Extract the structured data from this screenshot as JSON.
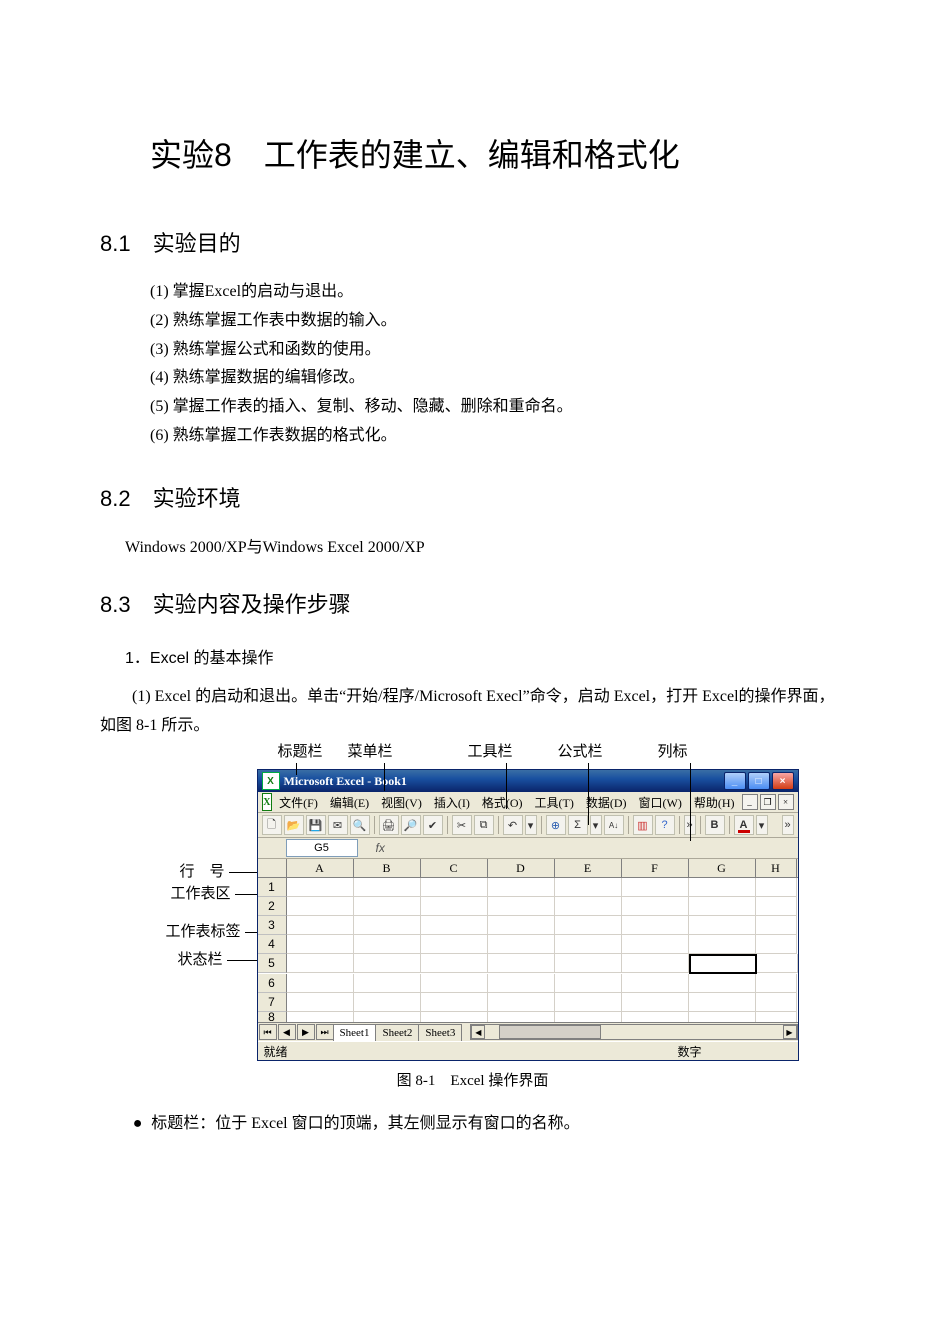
{
  "title": "实验8　工作表的建立、编辑和格式化",
  "sections": {
    "s81": {
      "heading": "8.1　实验目的",
      "items": [
        "(1)  掌握Excel的启动与退出。",
        "(2)  熟练掌握工作表中数据的输入。",
        "(3)  熟练掌握公式和函数的使用。",
        "(4)  熟练掌握数据的编辑修改。",
        "(5)  掌握工作表的插入、复制、移动、隐藏、删除和重命名。",
        "(6)  熟练掌握工作表数据的格式化。"
      ]
    },
    "s82": {
      "heading": "8.2　实验环境",
      "env": "Windows  2000/XP与Windows  Excel  2000/XP"
    },
    "s83": {
      "heading": "8.3　实验内容及操作步骤",
      "sub1": "1．Excel 的基本操作",
      "para1": "(1) Excel 的启动和退出。单击“开始/程序/Microsoft Execl”命令，启动 Excel，打开 Excel的操作界面，如图 8-1 所示。"
    }
  },
  "figure": {
    "top_annot": {
      "titlebar": "标题栏",
      "menubar": "菜单栏",
      "toolbar": "工具栏",
      "formulabar": "公式栏",
      "colheader": "列标"
    },
    "left_annot": {
      "rowheader": "行　号",
      "gridarea": "工作表区",
      "sheettabs": "工作表标签",
      "statusbar": "状态栏"
    },
    "excel": {
      "title": "Microsoft Excel - Book1",
      "menus": [
        "文件(F)",
        "编辑(E)",
        "视图(V)",
        "插入(I)",
        "格式(O)",
        "工具(T)",
        "数据(D)",
        "窗口(W)",
        "帮助(H)"
      ],
      "namebox": "G5",
      "fx": "fx",
      "cols": [
        "A",
        "B",
        "C",
        "D",
        "E",
        "F",
        "G",
        "H"
      ],
      "rows": [
        "1",
        "2",
        "3",
        "4",
        "5",
        "6",
        "7",
        "8"
      ],
      "tabs": [
        "Sheet1",
        "Sheet2",
        "Sheet3"
      ],
      "status_ready": "就绪",
      "status_num": "数字",
      "bold": "B",
      "fontA": "A"
    },
    "caption": "图 8-1　Excel 操作界面"
  },
  "bullet1": "标题栏：位于 Excel 窗口的顶端，其左侧显示有窗口的名称。"
}
